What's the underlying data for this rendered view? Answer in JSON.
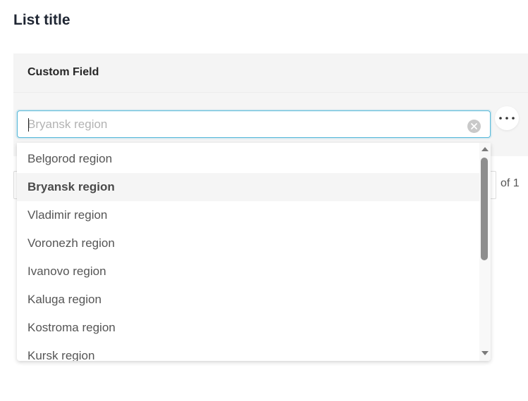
{
  "page": {
    "title": "List title"
  },
  "panel": {
    "header_label": "Custom Field"
  },
  "search": {
    "placeholder": "Bryansk region",
    "value": ""
  },
  "pager": {
    "suffix": "of 1"
  },
  "dropdown": {
    "selected": "Bryansk region",
    "options": [
      {
        "label": "Belgorod region"
      },
      {
        "label": "Bryansk region"
      },
      {
        "label": "Vladimir region"
      },
      {
        "label": "Voronezh region"
      },
      {
        "label": "Ivanovo region"
      },
      {
        "label": "Kaluga region"
      },
      {
        "label": "Kostroma region"
      },
      {
        "label": "Kursk region"
      }
    ]
  },
  "icons": {
    "clear": "clear-circle-icon",
    "more": "more-horizontal-icon",
    "scroll_up": "triangle-up-icon",
    "scroll_down": "triangle-down-icon"
  },
  "colors": {
    "focus_border": "#52b7d9",
    "selected_row": "#f5f5f5",
    "panel_bg": "#f5f5f5",
    "title_text": "#1f2633"
  }
}
